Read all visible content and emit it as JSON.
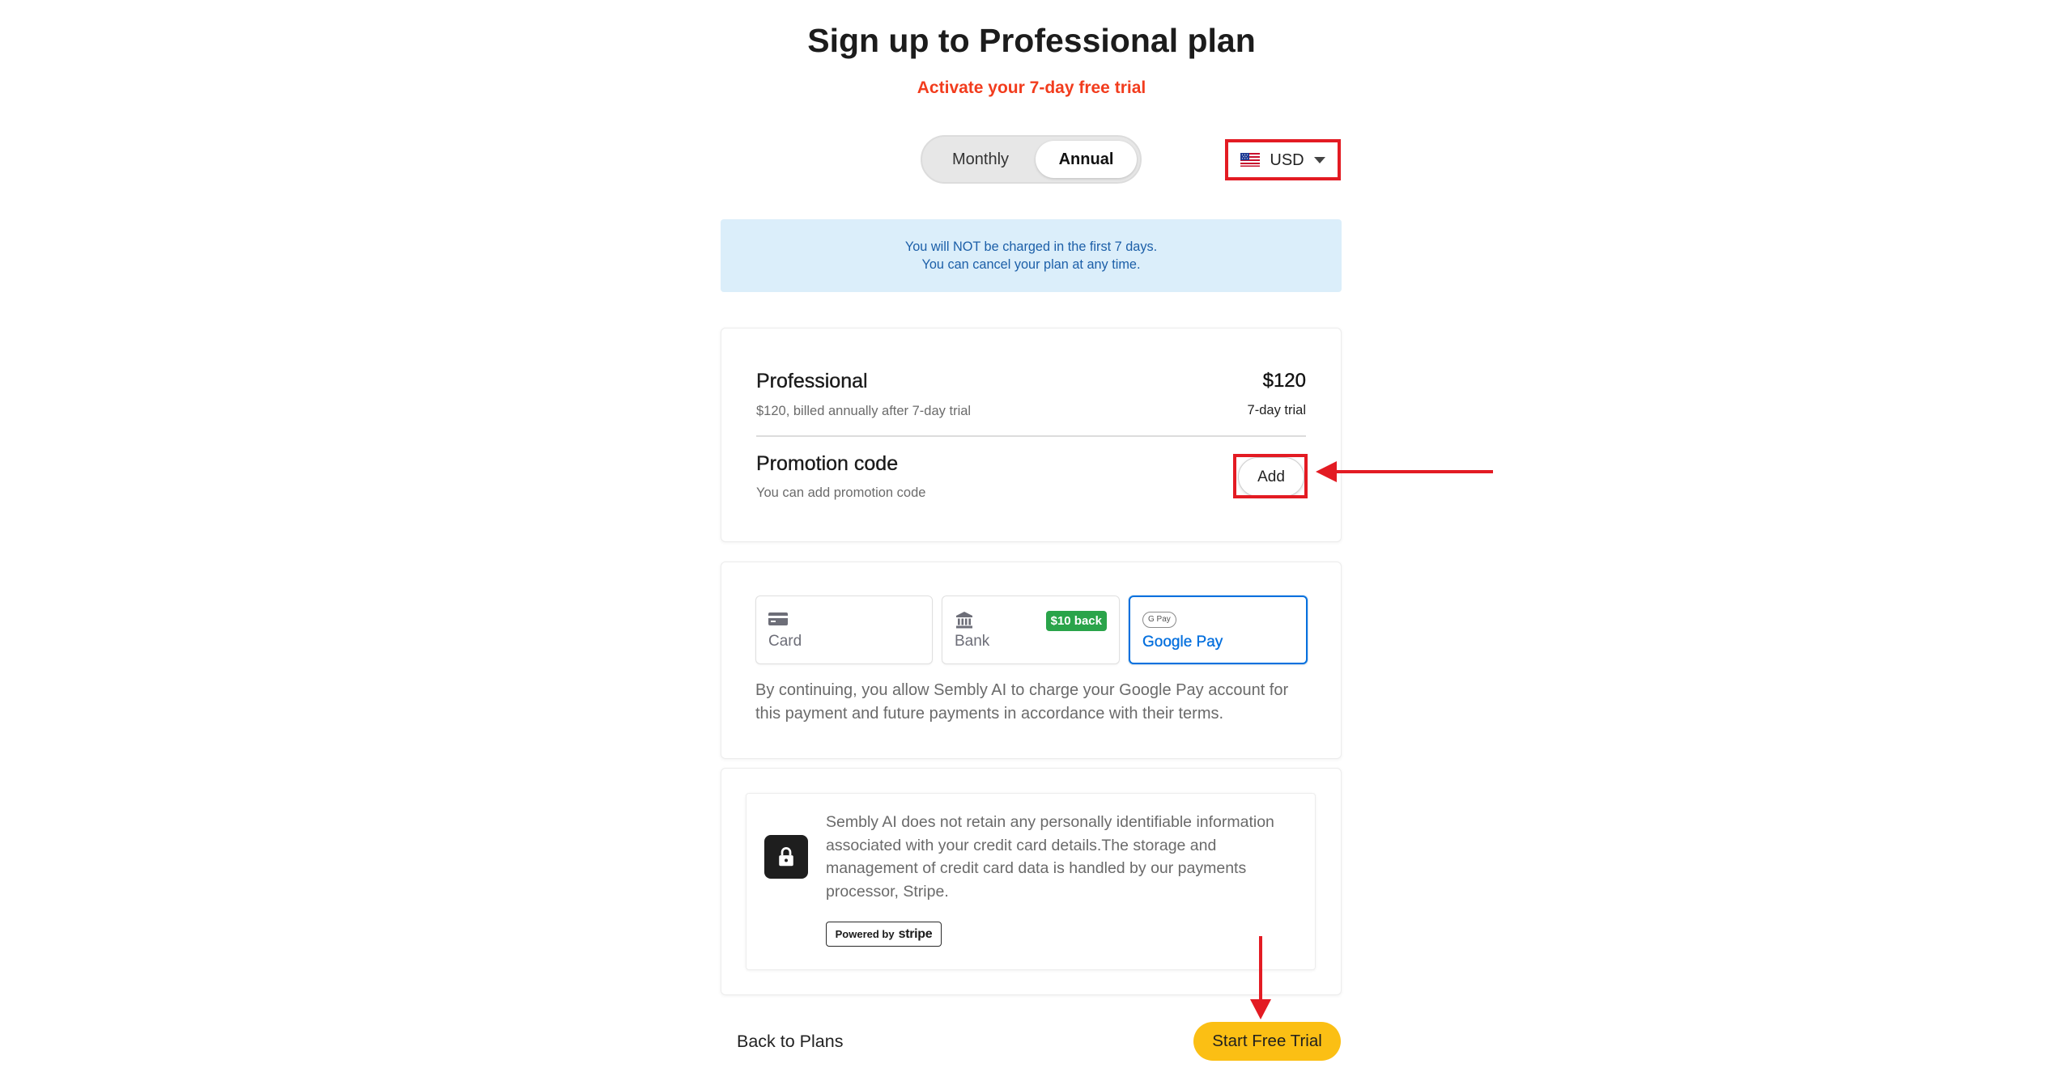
{
  "page": {
    "title": "Sign up to Professional plan",
    "subtitle": "Activate your 7-day free trial"
  },
  "billing_toggle": {
    "options": [
      "Monthly",
      "Annual"
    ],
    "selected": "Annual"
  },
  "currency": {
    "value": "USD",
    "flag_icon": "us-flag-icon",
    "caret_icon": "caret-down-icon"
  },
  "notice": {
    "lines": [
      "You will NOT be charged in the first 7 days.",
      "You can cancel your plan at any time."
    ]
  },
  "plan": {
    "name": "Professional",
    "description": "$120, billed annually after 7-day trial",
    "price": "$120",
    "price_note": "7-day trial"
  },
  "promotion": {
    "title": "Promotion code",
    "description": "You can add promotion code",
    "add_label": "Add"
  },
  "payment": {
    "methods": [
      {
        "label": "Card",
        "icon": "card-icon"
      },
      {
        "label": "Bank",
        "icon": "bank-icon",
        "badge": "$10 back"
      },
      {
        "label": "Google Pay",
        "icon": "google-pay-icon",
        "logo_text": "G Pay"
      }
    ],
    "selected": "Google Pay",
    "consent": "By continuing, you allow Sembly AI to charge your Google Pay account for this payment and future payments in accordance with their terms."
  },
  "security": {
    "icon": "lock-icon",
    "text": "Sembly AI does not retain any personally identifiable information associated with your credit card details.The storage and management of credit card data is handled by our payments processor, Stripe.",
    "badge_prefix": "Powered by",
    "badge_brand": "stripe"
  },
  "footer": {
    "back_label": "Back to Plans",
    "start_label": "Start Free Trial"
  },
  "colors": {
    "accent": "#f23c1d",
    "annotation": "#e31b23",
    "link": "#0570de",
    "info_bg": "#dbeefa",
    "info_text": "#1c5fa8",
    "badge": "#2aa44a",
    "cta": "#fbbf14"
  }
}
